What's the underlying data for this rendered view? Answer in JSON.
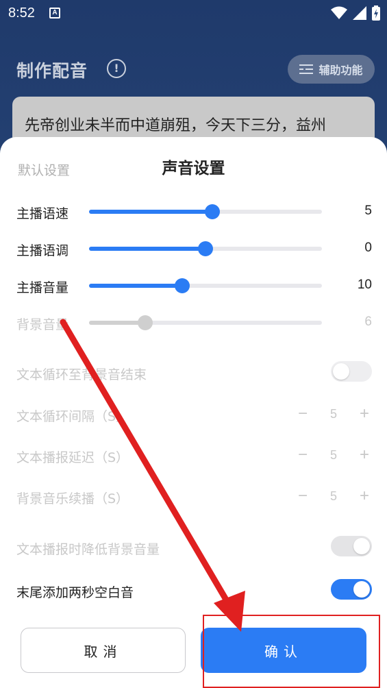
{
  "status_bar": {
    "time": "8:52",
    "notification_icon": "A",
    "icons": [
      "wifi-icon",
      "signal-icon",
      "battery-charging-icon"
    ]
  },
  "app": {
    "title": "制作配音",
    "assist_button_label": "辅助功能",
    "text_preview": "先帝创业未半而中道崩殂，今天下三分，益州"
  },
  "sheet": {
    "default_tab": "默认设置",
    "title": "声音设置",
    "sliders": [
      {
        "label": "主播语速",
        "value": "5",
        "fraction": 0.53,
        "enabled": true
      },
      {
        "label": "主播语调",
        "value": "0",
        "fraction": 0.5,
        "enabled": true
      },
      {
        "label": "主播音量",
        "value": "10",
        "fraction": 0.4,
        "enabled": true
      },
      {
        "label": "背景音量",
        "value": "6",
        "fraction": 0.24,
        "enabled": false
      }
    ],
    "loop_to_bg_end": {
      "label": "文本循环至背景音结束",
      "on": false
    },
    "steppers": [
      {
        "label": "文本循环间隔（S）",
        "value": "5",
        "minus": "−",
        "plus": "+"
      },
      {
        "label": "文本播报延迟（S）",
        "value": "5",
        "minus": "−",
        "plus": "+"
      },
      {
        "label": "背景音乐续播（S）",
        "value": "5",
        "minus": "−",
        "plus": "+"
      }
    ],
    "duck_bg": {
      "label": "文本播报时降低背景音量",
      "on": true,
      "enabled": false
    },
    "append_silence": {
      "label": "末尾添加两秒空白音",
      "on": true,
      "enabled": true
    },
    "cancel_label": "取消",
    "confirm_label": "确认"
  },
  "colors": {
    "accent": "#2b7cf4",
    "annotation": "#e02020"
  }
}
